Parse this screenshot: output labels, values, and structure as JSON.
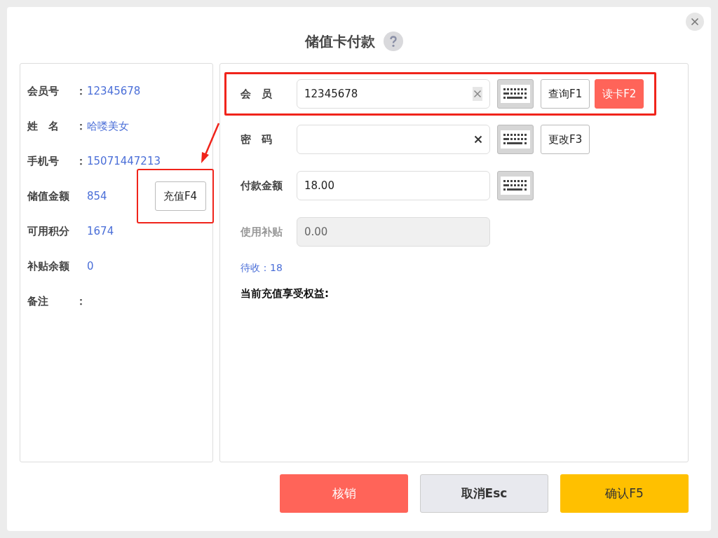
{
  "dialog": {
    "title": "储值卡付款"
  },
  "member_info": [
    {
      "label": "会员号",
      "colon": "：",
      "value": "12345678"
    },
    {
      "label": "姓　名",
      "colon": "：",
      "value": "哈喽美女"
    },
    {
      "label": "手机号",
      "colon": "：",
      "value": "15071447213"
    },
    {
      "label": "储值金额",
      "value": "854"
    },
    {
      "label": "可用积分",
      "value": "1674"
    },
    {
      "label": "补贴余额",
      "value": "0"
    },
    {
      "label": "备注",
      "colon": "："
    }
  ],
  "recharge_button": {
    "label": "充值F4",
    "highlighted": true
  },
  "form": [
    {
      "label": "会　员",
      "value": "12345678",
      "disabled": false,
      "clear": true,
      "clear_shaded": true,
      "keyboard": true,
      "highlighted": true,
      "buttons": [
        {
          "label": "查询F1",
          "kind": "default"
        },
        {
          "label": "读卡F2",
          "kind": "danger"
        }
      ]
    },
    {
      "label": "密　码",
      "disabled": false,
      "clear": true,
      "clear_shaded": false,
      "keyboard": true,
      "highlighted": false,
      "buttons": [
        {
          "label": "更改F3",
          "kind": "default"
        }
      ]
    },
    {
      "label": "付款金额",
      "value": "18.00",
      "disabled": false,
      "keyboard": true,
      "highlighted": false
    },
    {
      "label": "使用补贴",
      "value": "0.00",
      "disabled": true,
      "keyboard": false,
      "highlighted": false
    }
  ],
  "pending": "待收：18",
  "benefits_title": "当前充值享受权益:",
  "footer_buttons": [
    {
      "label": "核销",
      "kind": "danger"
    },
    {
      "label": "取消Esc",
      "kind": "default"
    },
    {
      "label": "确认F5",
      "kind": "primary"
    }
  ]
}
